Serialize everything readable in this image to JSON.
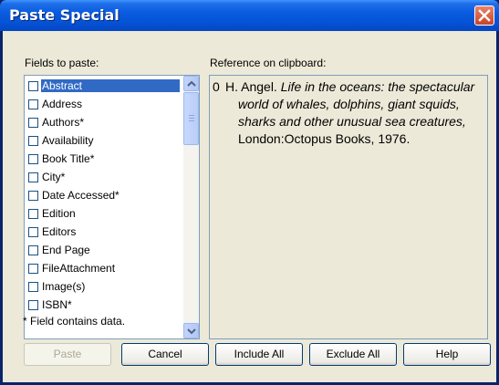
{
  "window": {
    "title": "Paste Special"
  },
  "fields": {
    "label": "Fields to paste:",
    "items": [
      {
        "label": "Abstract",
        "selected": true
      },
      {
        "label": "Address"
      },
      {
        "label": "Authors*"
      },
      {
        "label": "Availability"
      },
      {
        "label": "Book Title*"
      },
      {
        "label": "City*"
      },
      {
        "label": "Date Accessed*"
      },
      {
        "label": "Edition"
      },
      {
        "label": "Editors"
      },
      {
        "label": "End Page"
      },
      {
        "label": "FileAttachment"
      },
      {
        "label": "Image(s)"
      },
      {
        "label": "ISBN*"
      }
    ]
  },
  "reference": {
    "label": "Reference on clipboard:",
    "number": "0",
    "author": "H. Angel.",
    "title": "Life in the oceans: the spectacular world of whales, dolphins, giant squids, sharks and other unusual sea creatures,",
    "publisher": "London:Octopus Books, 1976."
  },
  "note": "* Field contains data.",
  "buttons": {
    "paste": "Paste",
    "cancel": "Cancel",
    "include_all": "Include All",
    "exclude_all": "Exclude All",
    "help": "Help"
  }
}
